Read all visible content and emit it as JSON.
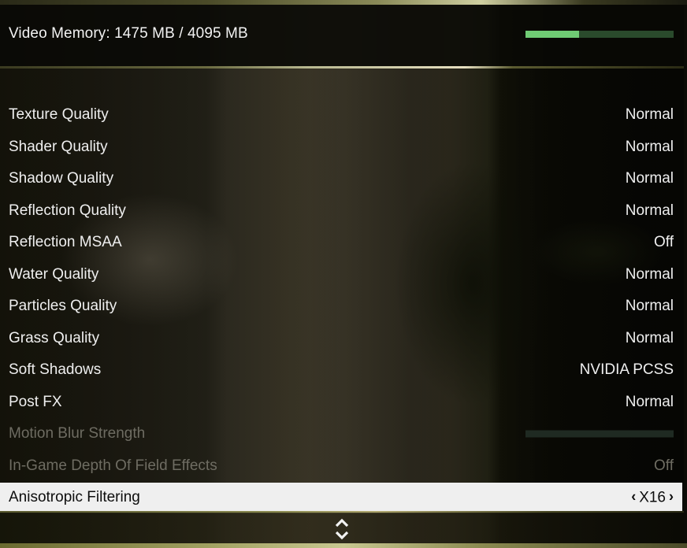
{
  "header": {
    "title": "Video Memory: 1475 MB / 4095 MB",
    "video_memory_used_mb": 1475,
    "video_memory_total_mb": 4095,
    "memory_bar_fill_fraction": 0.36
  },
  "colors": {
    "memory_bar_fill": "#6fcb74",
    "memory_bar_track": "#2a4a2c",
    "selected_row_bg": "#efefef",
    "disabled_text": "#6e6c62",
    "text": "#efefef"
  },
  "settings": [
    {
      "label": "Texture Quality",
      "value": "Normal",
      "state": "enabled",
      "type": "option"
    },
    {
      "label": "Shader Quality",
      "value": "Normal",
      "state": "enabled",
      "type": "option"
    },
    {
      "label": "Shadow Quality",
      "value": "Normal",
      "state": "enabled",
      "type": "option"
    },
    {
      "label": "Reflection Quality",
      "value": "Normal",
      "state": "enabled",
      "type": "option"
    },
    {
      "label": "Reflection MSAA",
      "value": "Off",
      "state": "enabled",
      "type": "option"
    },
    {
      "label": "Water Quality",
      "value": "Normal",
      "state": "enabled",
      "type": "option"
    },
    {
      "label": "Particles Quality",
      "value": "Normal",
      "state": "enabled",
      "type": "option"
    },
    {
      "label": "Grass Quality",
      "value": "Normal",
      "state": "enabled",
      "type": "option"
    },
    {
      "label": "Soft Shadows",
      "value": "NVIDIA PCSS",
      "state": "enabled",
      "type": "option"
    },
    {
      "label": "Post FX",
      "value": "Normal",
      "state": "enabled",
      "type": "option"
    },
    {
      "label": "Motion Blur Strength",
      "value": "",
      "state": "disabled",
      "type": "slider",
      "slider_fraction": 0
    },
    {
      "label": "In-Game Depth Of Field Effects",
      "value": "Off",
      "state": "disabled",
      "type": "option"
    },
    {
      "label": "Anisotropic Filtering",
      "value": "X16",
      "state": "selected",
      "type": "option"
    }
  ],
  "selected_row": {
    "prev_arrow": "‹",
    "next_arrow": "›"
  },
  "footer": {
    "scroll_icon": "up-down-chevron-icon"
  }
}
